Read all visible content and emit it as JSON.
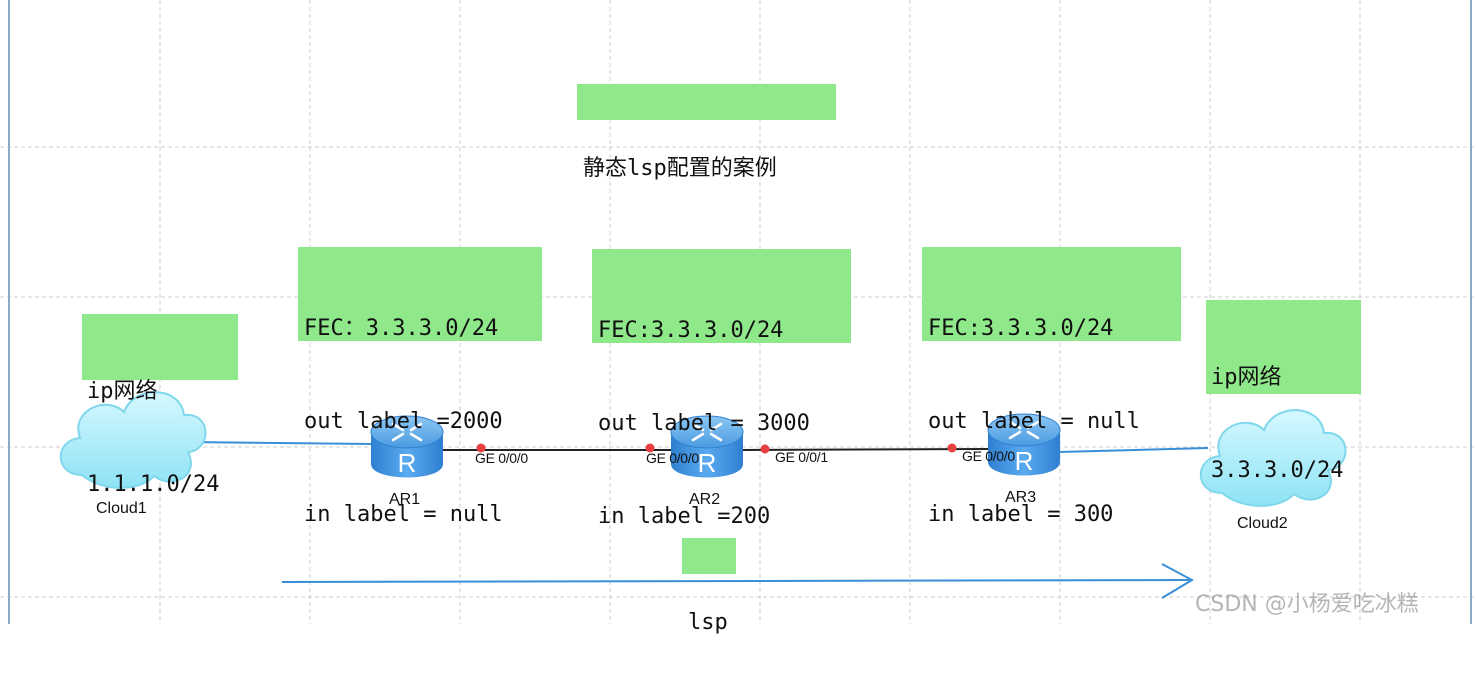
{
  "title": "静态lsp配置的案例",
  "clouds": [
    {
      "name": "Cloud1",
      "note": [
        "ip网络",
        "1.1.1.0/24"
      ]
    },
    {
      "name": "Cloud2",
      "note": [
        "ip网络",
        "3.3.3.0/24"
      ]
    }
  ],
  "routers": [
    {
      "name": "AR1",
      "note": [
        "FEC：3.3.3.0/24",
        "out label =2000",
        "in label = null"
      ]
    },
    {
      "name": "AR2",
      "note": [
        "FEC:3.3.3.0/24",
        "out label = 3000",
        "in label =200"
      ]
    },
    {
      "name": "AR3",
      "note": [
        "FEC:3.3.3.0/24",
        "out label = null",
        "in label = 300"
      ]
    }
  ],
  "ports": {
    "ar1_ge000": "GE 0/0/0",
    "ar2_ge000": "GE 0/0/0",
    "ar2_ge001": "GE 0/0/1",
    "ar3_ge000": "GE 0/0/0"
  },
  "lsp_label": "lsp",
  "watermark": "CSDN @小杨爱吃冰糕",
  "colors": {
    "note_bg": "#8fe88a",
    "link": "#3b8fd9",
    "port_dot": "#e84040",
    "router_body": "#3a8de0",
    "cloud": "#b8f0ff"
  }
}
